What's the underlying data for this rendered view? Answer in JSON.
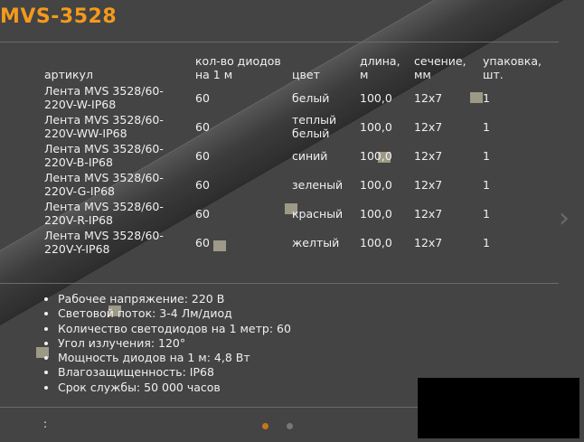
{
  "page": {
    "title": "MVS-3528"
  },
  "table": {
    "headers": [
      "артикул",
      "кол-во диодов на 1 м",
      "цвет",
      "длина, м",
      "сечение, мм",
      "упаковка, шт."
    ],
    "rows": [
      [
        "Лента MVS 3528/60-220V-W-IP68",
        "60",
        "белый",
        "100,0",
        "12x7",
        "1"
      ],
      [
        "Лента MVS 3528/60-220V-WW-IP68",
        "60",
        "теплый белый",
        "100,0",
        "12x7",
        "1"
      ],
      [
        "Лента MVS 3528/60-220V-B-IP68",
        "60",
        "синий",
        "100,0",
        "12x7",
        "1"
      ],
      [
        "Лента MVS 3528/60-220V-G-IP68",
        "60",
        "зеленый",
        "100,0",
        "12x7",
        "1"
      ],
      [
        "Лента MVS 3528/60-220V-R-IP68",
        "60",
        "красный",
        "100,0",
        "12x7",
        "1"
      ],
      [
        "Лента MVS 3528/60-220V-Y-IP68",
        "60",
        "желтый",
        "100,0",
        "12x7",
        "1"
      ]
    ]
  },
  "features": [
    "Рабочее напряжение: 220 В",
    "Световой поток: 3-4 Лм/диод",
    "Количество светодиодов на 1 метр: 60",
    "Угол излучения: 120°",
    "Мощность диодов на 1 м: 4,8 Вт",
    "Влагозащищенность:  IP68",
    "Срок службы: 50 000 часов"
  ],
  "footer": {
    "note": ":"
  },
  "carousel": {
    "active_slide": 1,
    "total_slides": 2,
    "next_icon": "chevron-right-icon"
  },
  "colors": {
    "accent": "#f39a1b",
    "background": "#444444",
    "text": "#f0f0f0"
  }
}
